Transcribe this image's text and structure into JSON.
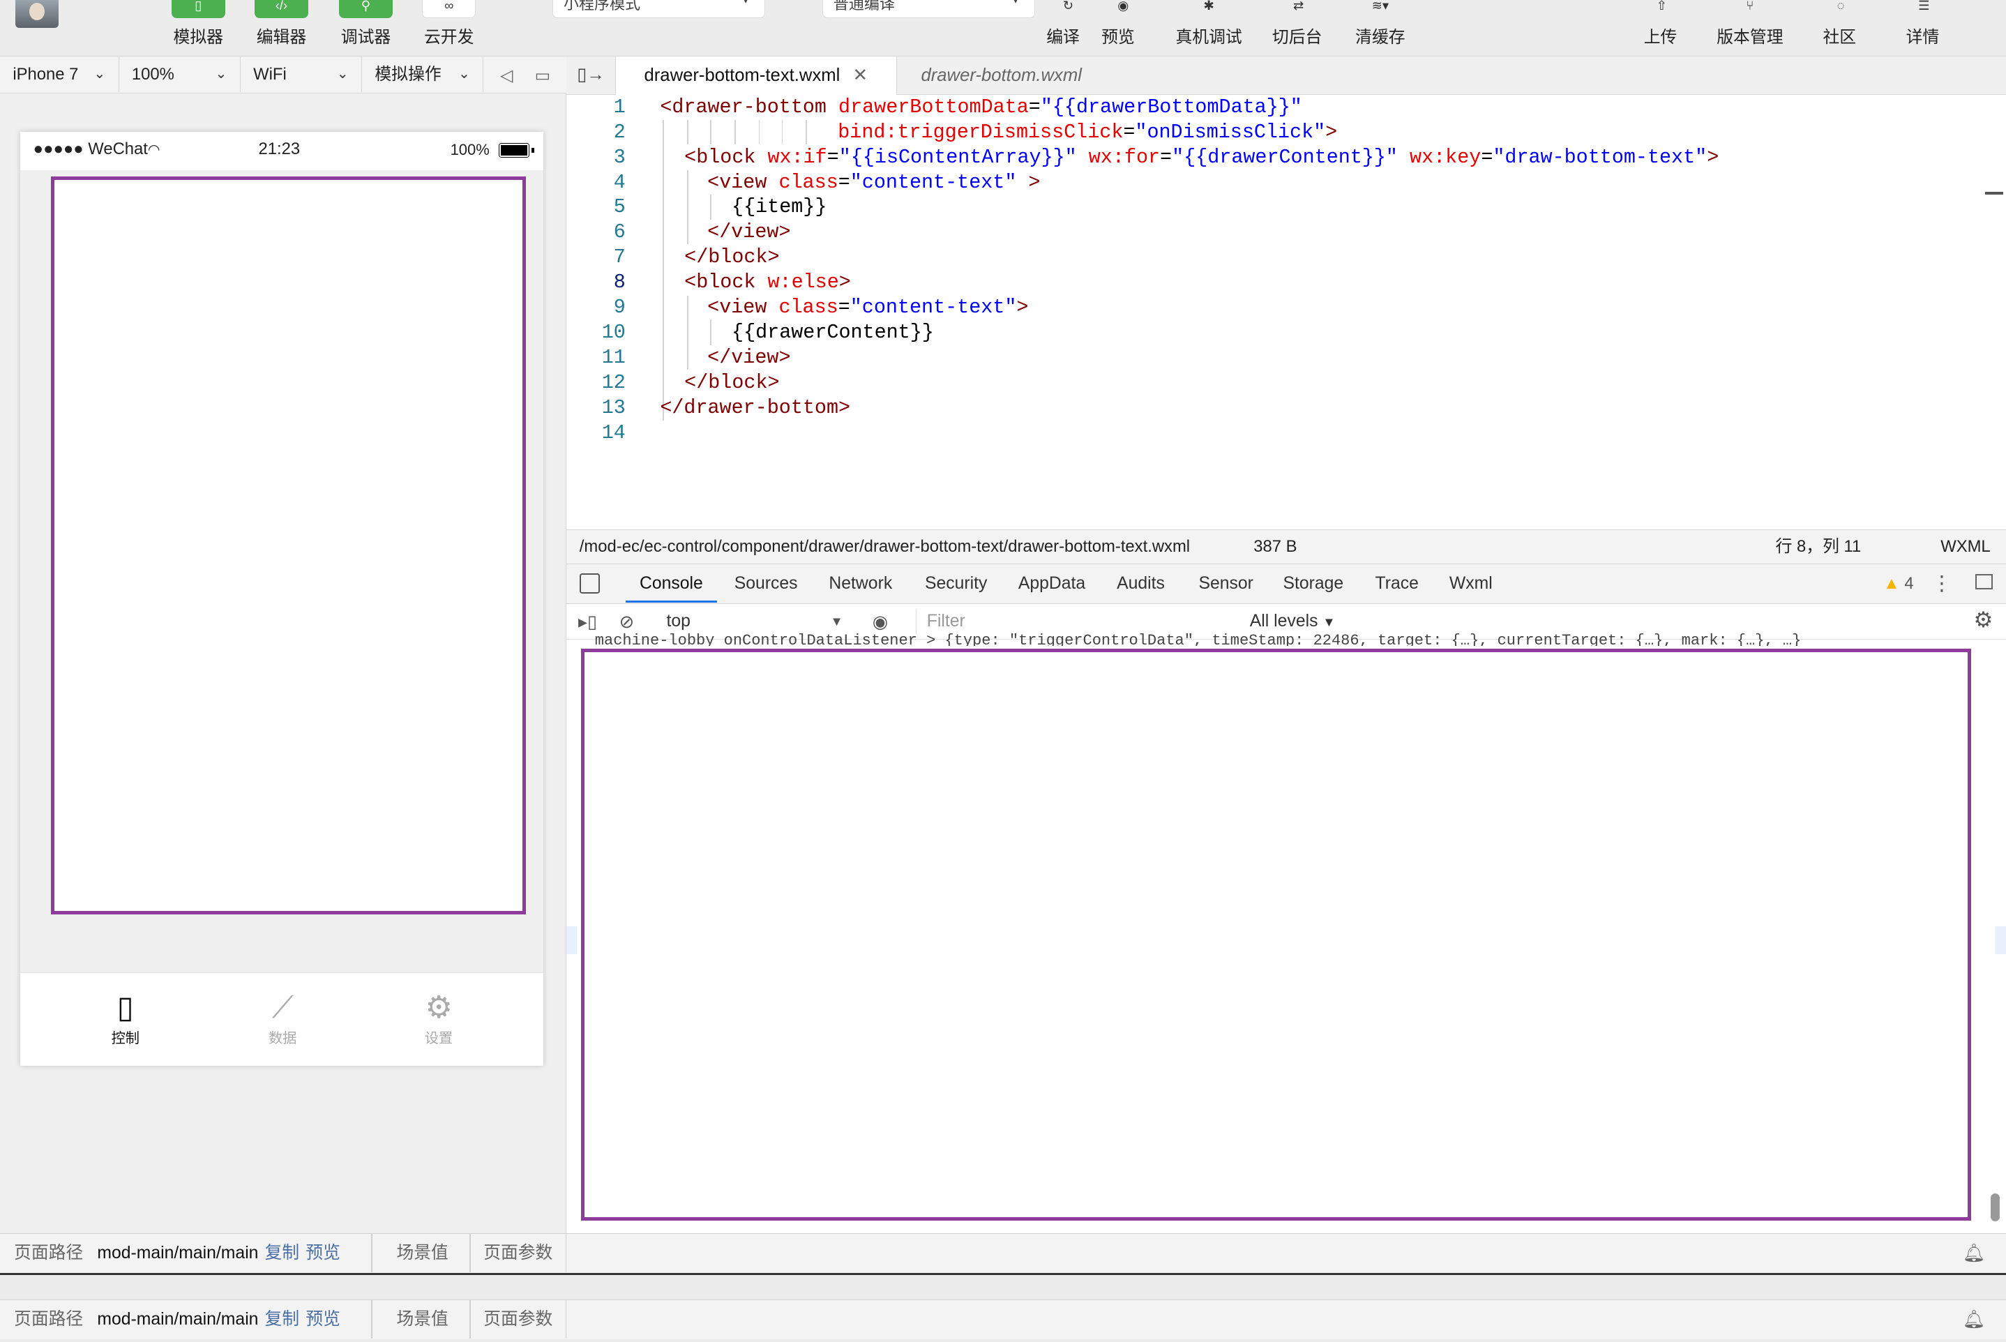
{
  "toolbar": {
    "simulator": "模拟器",
    "editor": "编辑器",
    "debugger": "调试器",
    "cloud": "云开发",
    "mode_select": "小程序模式",
    "compile_select": "普通编译",
    "compile": "编译",
    "preview": "预览",
    "real_debug": "真机调试",
    "background": "切后台",
    "clear_cache": "清缓存",
    "upload": "上传",
    "version": "版本管理",
    "community": "社区",
    "details": "详情"
  },
  "simbar": {
    "device": "iPhone 7",
    "zoom": "100%",
    "network": "WiFi",
    "simulate_ops": "模拟操作"
  },
  "phone": {
    "carrier": "●●●●● WeChat",
    "time": "21:23",
    "battery_pct": "100%",
    "tabs": [
      {
        "label": "控制",
        "icon": "phone-icon"
      },
      {
        "label": "数据",
        "icon": "chart-icon"
      },
      {
        "label": "设置",
        "icon": "gear-icon"
      }
    ]
  },
  "editor": {
    "tab_active": "drawer-bottom-text.wxml",
    "tab_inactive": "drawer-bottom.wxml",
    "line_numbers": [
      "1",
      "2",
      "3",
      "4",
      "5",
      "6",
      "7",
      "8",
      "9",
      "10",
      "11",
      "12",
      "13",
      "14"
    ],
    "file_path": "/mod-ec/ec-control/component/drawer/drawer-bottom-text/drawer-bottom-text.wxml",
    "file_size": "387 B",
    "cursor_pos": "行 8，列 11",
    "language": "WXML"
  },
  "code": {
    "l1_open": "<",
    "l1_tag": "drawer-bottom",
    "l1_attr": "drawerBottomData",
    "l1_eq": "=",
    "l1_val": "\"{{drawerBottomData}}\"",
    "l2_attr": "bind:triggerDismissClick",
    "l2_eq": "=",
    "l2_val": "\"onDismissClick\"",
    "l2_close": ">",
    "l3_open": "<",
    "l3_tag": "block",
    "l3_a1": "wx:if",
    "l3_v1": "\"{{isContentArray}}\"",
    "l3_a2": "wx:for",
    "l3_v2": "\"{{drawerContent}}\"",
    "l3_a3": "wx:key",
    "l3_v3": "\"draw-bottom-text\"",
    "l3_close": ">",
    "l4_open": "<",
    "l4_tag": "view",
    "l4_attr": "class",
    "l4_val": "\"content-text\"",
    "l4_close": " >",
    "l5_txt": "{{item}}",
    "l6": "</view>",
    "l7": "</block>",
    "l8_open": "<",
    "l8_tag": "block",
    "l8_attr": "w:else",
    "l8_close": ">",
    "l9_open": "<",
    "l9_tag": "view",
    "l9_attr": "class",
    "l9_val": "\"content-text\"",
    "l9_close": ">",
    "l10_txt": "{{drawerContent}}",
    "l11": "</view>",
    "l12": "</block>",
    "l13": "</drawer-bottom>",
    "eq": "="
  },
  "devtools": {
    "tabs": [
      "Console",
      "Sources",
      "Network",
      "Security",
      "AppData",
      "Audits",
      "Sensor",
      "Storage",
      "Trace",
      "Wxml"
    ],
    "warnings": "4",
    "context": "top",
    "filter_placeholder": "Filter",
    "levels": "All levels",
    "partial_log": "machine-lobby onControlDataListener  > {type: \"triggerControlData\", timeStamp: 22486, target: {…}, currentTarget: {…}, mark: {…}, …}"
  },
  "bottom": {
    "path_label": "页面路径",
    "path_value": "mod-main/main/main",
    "copy": "复制",
    "preview": "预览",
    "scene": "场景值",
    "params": "页面参数"
  }
}
